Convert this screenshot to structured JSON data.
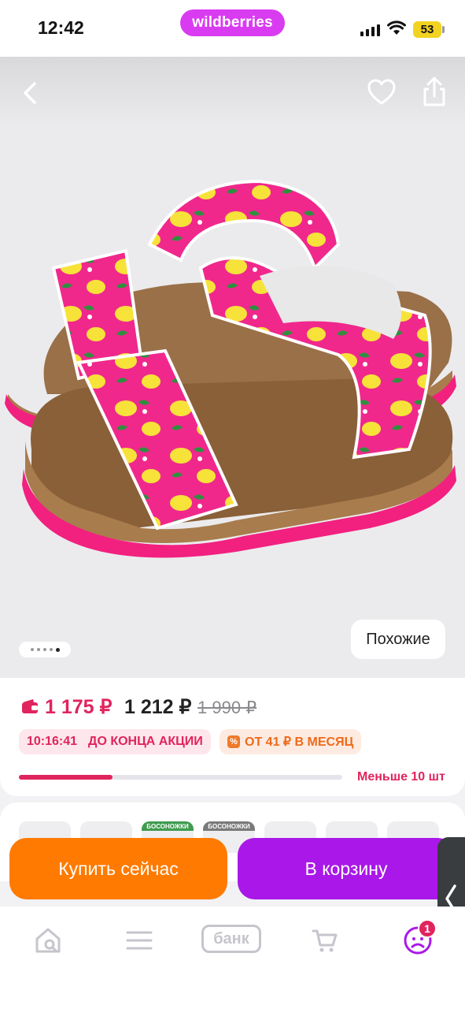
{
  "status_bar": {
    "time": "12:42",
    "battery": "53"
  },
  "header": {
    "brand": "wildberries"
  },
  "gallery": {
    "image_icon": "sandals-product-image",
    "dots_count": 5,
    "active_dot": 5,
    "similar_label": "Похожие"
  },
  "price": {
    "wallet_price": "1 175 ₽",
    "price": "1 212 ₽",
    "old_price": "1 990 ₽"
  },
  "promo": {
    "timer": "10:16:41",
    "timer_label": "ДО КОНЦА АКЦИИ",
    "installment": "ОТ 41 ₽ В МЕСЯЦ"
  },
  "stock": {
    "label": "Меньше 10 шт",
    "fill_fraction": 0.29
  },
  "variants": {
    "tag_1": "БОСОНОЖКИ",
    "tag_2": "БОСОНОЖКИ"
  },
  "actions": {
    "buy_now": "Купить сейчас",
    "add_to_cart": "В корзину"
  },
  "bottom_nav": {
    "bank": "банк",
    "profile_badge": "1"
  },
  "colors": {
    "brand": "#d93cf0",
    "accent_red": "#e0245e",
    "buy_now": "#ff7a00",
    "cart": "#a918e8"
  }
}
